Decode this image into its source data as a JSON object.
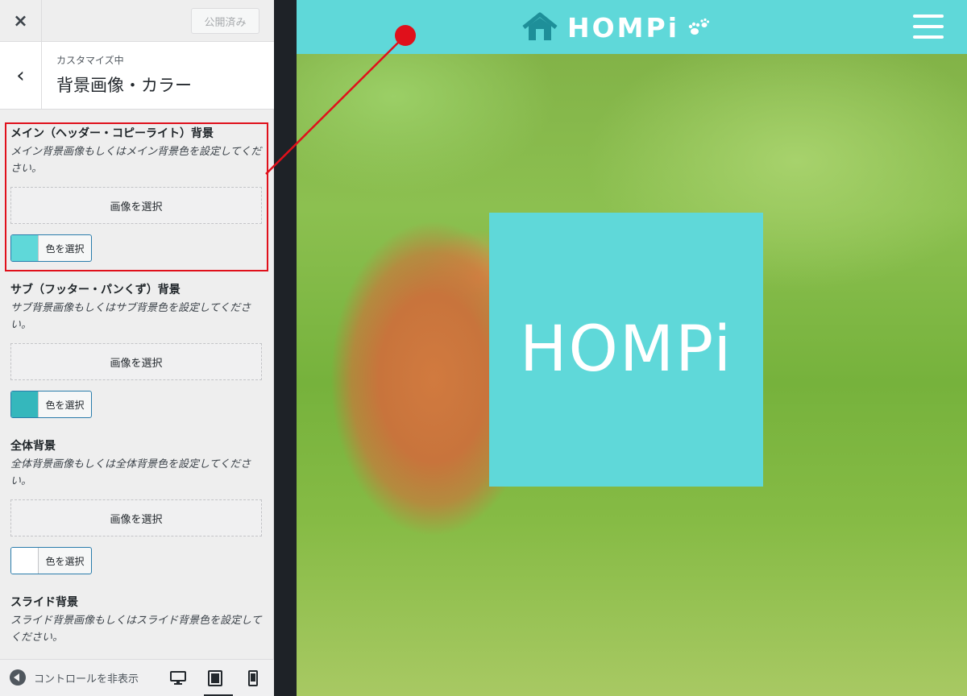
{
  "topbar": {
    "close_symbol": "×",
    "publish_label": "公開済み"
  },
  "section": {
    "back_symbol": "‹",
    "customizing_label": "カスタマイズ中",
    "title": "背景画像・カラー"
  },
  "controls": [
    {
      "title": "メイン（ヘッダー・コピーライト）背景",
      "description": "メイン背景画像もしくはメイン背景色を設定してください。",
      "image_button": "画像を選択",
      "color_button": "色を選択",
      "swatch_color": "#5fd8d9"
    },
    {
      "title": "サブ（フッター・パンくず）背景",
      "description": "サブ背景画像もしくはサブ背景色を設定してください。",
      "image_button": "画像を選択",
      "color_button": "色を選択",
      "swatch_color": "#35b7bc"
    },
    {
      "title": "全体背景",
      "description": "全体背景画像もしくは全体背景色を設定してください。",
      "image_button": "画像を選択",
      "color_button": "色を選択",
      "swatch_color": "#ffffff"
    },
    {
      "title": "スライド背景",
      "description": "スライド背景画像もしくはスライド背景色を設定してください。"
    }
  ],
  "footer": {
    "collapse_label": "コントロールを非表示",
    "devices": [
      "desktop-icon",
      "tablet-icon",
      "mobile-icon"
    ]
  },
  "preview": {
    "header_color": "#5fd8d9",
    "site_logo": "HOMPi",
    "hero_logo": "HOMPi"
  },
  "annotation_color": "#e0101b"
}
